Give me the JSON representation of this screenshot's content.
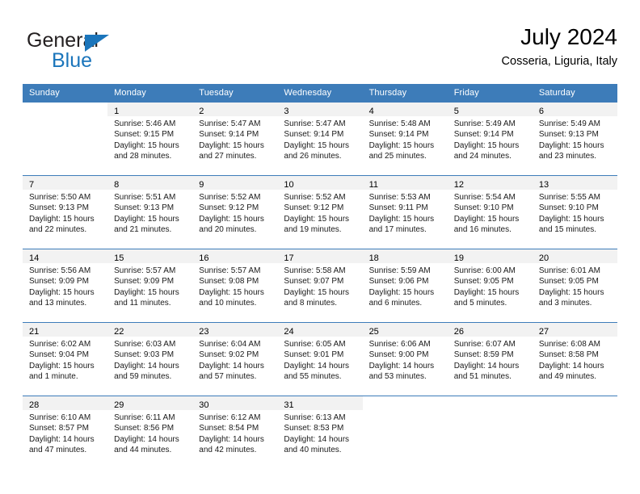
{
  "brand": {
    "name_top": "General",
    "name_bottom": "Blue",
    "accent_color": "#1b75bb"
  },
  "header": {
    "title": "July 2024",
    "subtitle": "Cosseria, Liguria, Italy"
  },
  "theme": {
    "header_row_bg": "#3d7cb9",
    "daynum_band_bg": "#f2f2f2",
    "grid_line": "#3d7cb9",
    "text": "#000000"
  },
  "weekdays": [
    "Sunday",
    "Monday",
    "Tuesday",
    "Wednesday",
    "Thursday",
    "Friday",
    "Saturday"
  ],
  "labels": {
    "sunrise_prefix": "Sunrise:",
    "sunset_prefix": "Sunset:",
    "daylight_prefix": "Daylight:"
  },
  "weeks": [
    [
      {
        "day": "",
        "empty": true
      },
      {
        "day": "1",
        "sunrise": "Sunrise: 5:46 AM",
        "sunset": "Sunset: 9:15 PM",
        "daylight_l1": "Daylight: 15 hours",
        "daylight_l2": "and 28 minutes."
      },
      {
        "day": "2",
        "sunrise": "Sunrise: 5:47 AM",
        "sunset": "Sunset: 9:14 PM",
        "daylight_l1": "Daylight: 15 hours",
        "daylight_l2": "and 27 minutes."
      },
      {
        "day": "3",
        "sunrise": "Sunrise: 5:47 AM",
        "sunset": "Sunset: 9:14 PM",
        "daylight_l1": "Daylight: 15 hours",
        "daylight_l2": "and 26 minutes."
      },
      {
        "day": "4",
        "sunrise": "Sunrise: 5:48 AM",
        "sunset": "Sunset: 9:14 PM",
        "daylight_l1": "Daylight: 15 hours",
        "daylight_l2": "and 25 minutes."
      },
      {
        "day": "5",
        "sunrise": "Sunrise: 5:49 AM",
        "sunset": "Sunset: 9:14 PM",
        "daylight_l1": "Daylight: 15 hours",
        "daylight_l2": "and 24 minutes."
      },
      {
        "day": "6",
        "sunrise": "Sunrise: 5:49 AM",
        "sunset": "Sunset: 9:13 PM",
        "daylight_l1": "Daylight: 15 hours",
        "daylight_l2": "and 23 minutes."
      }
    ],
    [
      {
        "day": "7",
        "sunrise": "Sunrise: 5:50 AM",
        "sunset": "Sunset: 9:13 PM",
        "daylight_l1": "Daylight: 15 hours",
        "daylight_l2": "and 22 minutes."
      },
      {
        "day": "8",
        "sunrise": "Sunrise: 5:51 AM",
        "sunset": "Sunset: 9:13 PM",
        "daylight_l1": "Daylight: 15 hours",
        "daylight_l2": "and 21 minutes."
      },
      {
        "day": "9",
        "sunrise": "Sunrise: 5:52 AM",
        "sunset": "Sunset: 9:12 PM",
        "daylight_l1": "Daylight: 15 hours",
        "daylight_l2": "and 20 minutes."
      },
      {
        "day": "10",
        "sunrise": "Sunrise: 5:52 AM",
        "sunset": "Sunset: 9:12 PM",
        "daylight_l1": "Daylight: 15 hours",
        "daylight_l2": "and 19 minutes."
      },
      {
        "day": "11",
        "sunrise": "Sunrise: 5:53 AM",
        "sunset": "Sunset: 9:11 PM",
        "daylight_l1": "Daylight: 15 hours",
        "daylight_l2": "and 17 minutes."
      },
      {
        "day": "12",
        "sunrise": "Sunrise: 5:54 AM",
        "sunset": "Sunset: 9:10 PM",
        "daylight_l1": "Daylight: 15 hours",
        "daylight_l2": "and 16 minutes."
      },
      {
        "day": "13",
        "sunrise": "Sunrise: 5:55 AM",
        "sunset": "Sunset: 9:10 PM",
        "daylight_l1": "Daylight: 15 hours",
        "daylight_l2": "and 15 minutes."
      }
    ],
    [
      {
        "day": "14",
        "sunrise": "Sunrise: 5:56 AM",
        "sunset": "Sunset: 9:09 PM",
        "daylight_l1": "Daylight: 15 hours",
        "daylight_l2": "and 13 minutes."
      },
      {
        "day": "15",
        "sunrise": "Sunrise: 5:57 AM",
        "sunset": "Sunset: 9:09 PM",
        "daylight_l1": "Daylight: 15 hours",
        "daylight_l2": "and 11 minutes."
      },
      {
        "day": "16",
        "sunrise": "Sunrise: 5:57 AM",
        "sunset": "Sunset: 9:08 PM",
        "daylight_l1": "Daylight: 15 hours",
        "daylight_l2": "and 10 minutes."
      },
      {
        "day": "17",
        "sunrise": "Sunrise: 5:58 AM",
        "sunset": "Sunset: 9:07 PM",
        "daylight_l1": "Daylight: 15 hours",
        "daylight_l2": "and 8 minutes."
      },
      {
        "day": "18",
        "sunrise": "Sunrise: 5:59 AM",
        "sunset": "Sunset: 9:06 PM",
        "daylight_l1": "Daylight: 15 hours",
        "daylight_l2": "and 6 minutes."
      },
      {
        "day": "19",
        "sunrise": "Sunrise: 6:00 AM",
        "sunset": "Sunset: 9:05 PM",
        "daylight_l1": "Daylight: 15 hours",
        "daylight_l2": "and 5 minutes."
      },
      {
        "day": "20",
        "sunrise": "Sunrise: 6:01 AM",
        "sunset": "Sunset: 9:05 PM",
        "daylight_l1": "Daylight: 15 hours",
        "daylight_l2": "and 3 minutes."
      }
    ],
    [
      {
        "day": "21",
        "sunrise": "Sunrise: 6:02 AM",
        "sunset": "Sunset: 9:04 PM",
        "daylight_l1": "Daylight: 15 hours",
        "daylight_l2": "and 1 minute."
      },
      {
        "day": "22",
        "sunrise": "Sunrise: 6:03 AM",
        "sunset": "Sunset: 9:03 PM",
        "daylight_l1": "Daylight: 14 hours",
        "daylight_l2": "and 59 minutes."
      },
      {
        "day": "23",
        "sunrise": "Sunrise: 6:04 AM",
        "sunset": "Sunset: 9:02 PM",
        "daylight_l1": "Daylight: 14 hours",
        "daylight_l2": "and 57 minutes."
      },
      {
        "day": "24",
        "sunrise": "Sunrise: 6:05 AM",
        "sunset": "Sunset: 9:01 PM",
        "daylight_l1": "Daylight: 14 hours",
        "daylight_l2": "and 55 minutes."
      },
      {
        "day": "25",
        "sunrise": "Sunrise: 6:06 AM",
        "sunset": "Sunset: 9:00 PM",
        "daylight_l1": "Daylight: 14 hours",
        "daylight_l2": "and 53 minutes."
      },
      {
        "day": "26",
        "sunrise": "Sunrise: 6:07 AM",
        "sunset": "Sunset: 8:59 PM",
        "daylight_l1": "Daylight: 14 hours",
        "daylight_l2": "and 51 minutes."
      },
      {
        "day": "27",
        "sunrise": "Sunrise: 6:08 AM",
        "sunset": "Sunset: 8:58 PM",
        "daylight_l1": "Daylight: 14 hours",
        "daylight_l2": "and 49 minutes."
      }
    ],
    [
      {
        "day": "28",
        "sunrise": "Sunrise: 6:10 AM",
        "sunset": "Sunset: 8:57 PM",
        "daylight_l1": "Daylight: 14 hours",
        "daylight_l2": "and 47 minutes."
      },
      {
        "day": "29",
        "sunrise": "Sunrise: 6:11 AM",
        "sunset": "Sunset: 8:56 PM",
        "daylight_l1": "Daylight: 14 hours",
        "daylight_l2": "and 44 minutes."
      },
      {
        "day": "30",
        "sunrise": "Sunrise: 6:12 AM",
        "sunset": "Sunset: 8:54 PM",
        "daylight_l1": "Daylight: 14 hours",
        "daylight_l2": "and 42 minutes."
      },
      {
        "day": "31",
        "sunrise": "Sunrise: 6:13 AM",
        "sunset": "Sunset: 8:53 PM",
        "daylight_l1": "Daylight: 14 hours",
        "daylight_l2": "and 40 minutes."
      },
      {
        "day": "",
        "empty": true
      },
      {
        "day": "",
        "empty": true
      },
      {
        "day": "",
        "empty": true
      }
    ]
  ]
}
